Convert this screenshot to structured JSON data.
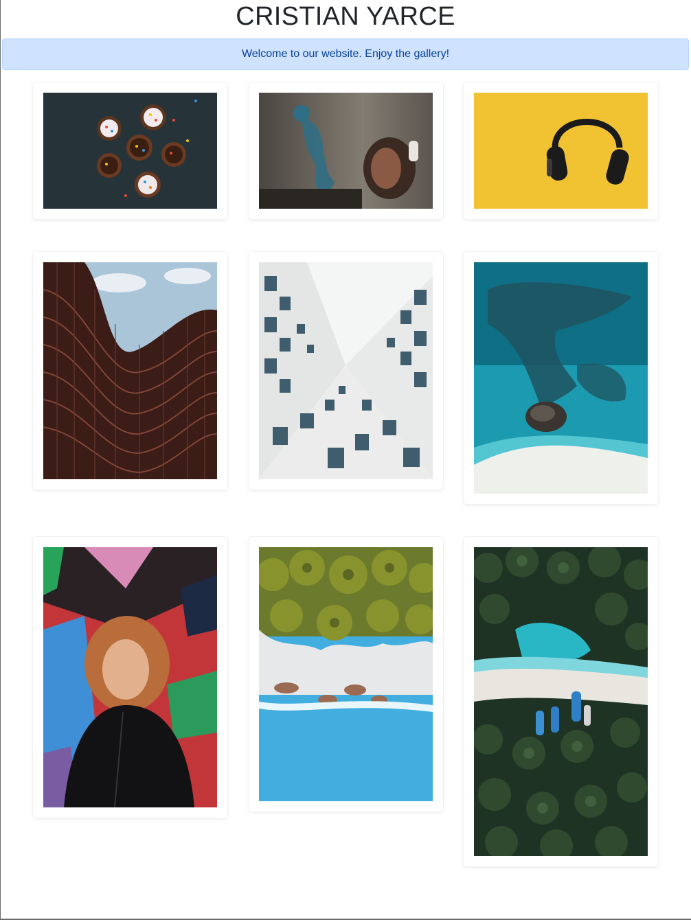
{
  "page": {
    "title": "CRISTIAN YARCE",
    "alert_message": "Welcome to our website. Enjoy the gallery!"
  },
  "colors": {
    "alert_bg": "#cfe2ff",
    "alert_text": "#084298",
    "title_text": "#212529"
  }
}
